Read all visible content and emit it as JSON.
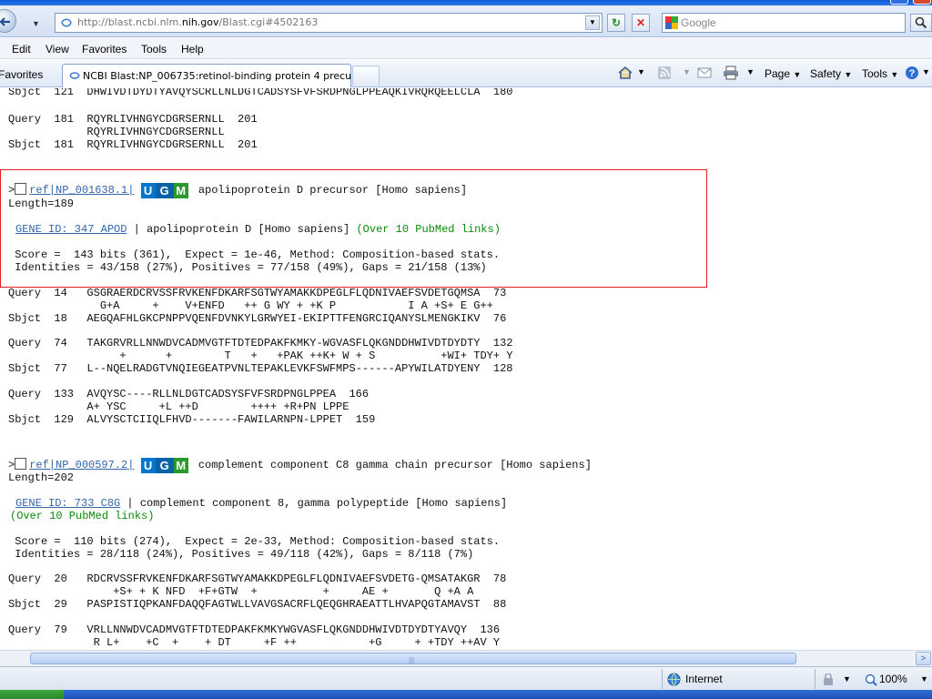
{
  "browser": {
    "address_plain": "http://blast.ncbi.nlm.",
    "address_host": "nih.gov",
    "address_rest": "/Blast.cgi#4502163",
    "search_placeholder": "Google",
    "menu": [
      "Edit",
      "View",
      "Favorites",
      "Tools",
      "Help"
    ],
    "favorites_label": "Favorites",
    "tab_title": "NCBI Blast:NP_006735:retinol-binding protein 4 precu...",
    "commands": {
      "page": "Page",
      "safety": "Safety",
      "tools": "Tools"
    },
    "zone": "Internet",
    "zoom": "100%"
  },
  "content": {
    "top_lines": [
      "Sbjct  121  DHWIVDTDYDTYAVQYSCRLLNLDGTCADSYSFVFSRDPNGLPPEAQKIVRQRQEELCLA  180",
      "",
      "Query  181  RQYRLIVHNGYCDGRSERNLL  201",
      "            RQYRLIVHNGYCDGRSERNLL",
      "Sbjct  181  RQYRLIVHNGYCDGRSERNLL  201"
    ],
    "hits": [
      {
        "accession": "ref|NP_001638.1|",
        "description": "apolipoprotein D precursor [Homo sapiens]",
        "length": "Length=189",
        "gene_link": "GENE ID: 347 APOD",
        "gene_desc": " | apolipoprotein D [Homo sapiens] ",
        "pubmed": "(Over 10 PubMed links)",
        "score": " Score =  143 bits (361),  Expect = 1e-46, Method: Composition-based stats.",
        "identities": " Identities = 43/158 (27%), Positives = 77/158 (49%), Gaps = 21/158 (13%)",
        "alignment": [
          "Query  14   GSGRAERDCRVSSFRVKENFDKARFSGTWYAMAKKDPEGLFLQDNIVAEFSVDETGQMSA  73",
          "              G+A     +    V+ENFD   ++ G WY + +K P           I A +S+ E G++",
          "Sbjct  18   AEGQAFHLGKCPNPPVQENFDVNKYLGRWYEI-EKIPTTFENGRCIQANYSLMENGKIKV  76",
          "",
          "Query  74   TAKGRVRLLNNWDVCADMVGTFTDTEDPAKFKMKY-WGVASFLQKGNDDHWIVDTDYDTY  132",
          "                 +      +        T   +   +PAK ++K+ W + S          +WI+ TDY+ Y",
          "Sbjct  77   L--NQELRADGTVNQIEGEATPVNLTEPAKLEVKFSWFMPS------APYWILATDYENY  128",
          "",
          "Query  133  AVQYSC----RLLNLDGTCADSYSFVFSRDPNGLPPEA  166",
          "            A+ YSC     +L ++D        ++++ +R+PN LPPE",
          "Sbjct  129  ALVYSCTCIIQLFHVD-------FAWILARNPN-LPPET  159"
        ]
      },
      {
        "accession": "ref|NP_000597.2|",
        "description": "complement component C8 gamma chain precursor [Homo sapiens]",
        "length": "Length=202",
        "gene_link": "GENE ID: 733 C8G",
        "gene_desc": " | complement component 8, gamma polypeptide [Homo sapiens]",
        "pubmed": "(Over 10 PubMed links)",
        "score": " Score =  110 bits (274),  Expect = 2e-33, Method: Composition-based stats.",
        "identities": " Identities = 28/118 (24%), Positives = 49/118 (42%), Gaps = 8/118 (7%)",
        "alignment": [
          "Query  20   RDCRVSSFRVKENFDKARFSGTWYAMAKKDPEGLFLQDNIVAEFSVDETG-QMSATAKGR  78",
          "                +S+ + K NFD  +F+GTW  +          +     AE +       Q +A A",
          "Sbjct  29   PASPISTIQPKANFDAQQFAGTWLLVAVGSACRFLQEQGHRAEATTLHVAPQGTAMAVST  88",
          "",
          "Query  79   VRLLNNWDVCADMVGTFTDTEDPAKFKMKYWGVASFLQKGNDDHWIVDTDYDTYAVQY  136",
          "             R L+    +C  +    + DT     +F ++           +G     + +TDY ++AV Y"
        ]
      }
    ]
  }
}
